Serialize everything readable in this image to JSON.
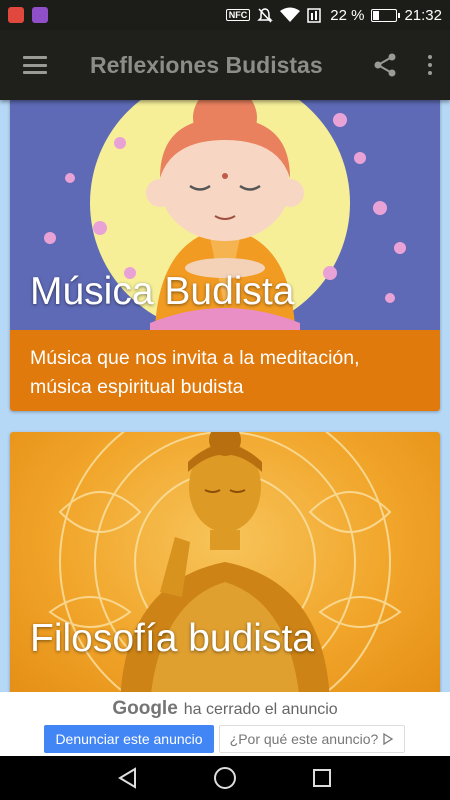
{
  "status_bar": {
    "battery_text": "22 %",
    "battery_level": 0.22,
    "time": "21:32",
    "nfc_label": "NFC",
    "icons": [
      "mail-notification-icon",
      "app-notification-icon",
      "nfc-icon",
      "mute-icon",
      "wifi-icon",
      "signal-icon",
      "battery-icon"
    ]
  },
  "app_bar": {
    "title": "Reflexiones Budistas",
    "color": "#1f201b"
  },
  "cards": [
    {
      "title": "Música Budista",
      "description": "Música que nos invita a la meditación, música espiritual budista",
      "color": "#e07a0c"
    },
    {
      "title": "Filosofía budista",
      "color": "#e07a0c"
    }
  ],
  "ad": {
    "brand": "Google",
    "closed_text": "ha cerrado el anuncio",
    "report_label": "Denunciar este anuncio",
    "why_label": "¿Por qué este anuncio?",
    "accent": "#4285f4"
  },
  "colors": {
    "background": "#b6d8f7",
    "orange": "#e07a0c"
  }
}
